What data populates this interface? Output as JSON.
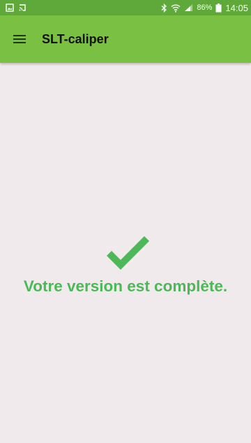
{
  "status_bar": {
    "battery_percent": "86%",
    "time": "14:05",
    "icons": [
      "gallery-notification-icon",
      "cast-notification-icon",
      "bluetooth-icon",
      "wifi-icon",
      "signal-icon",
      "battery-icon"
    ]
  },
  "app_bar": {
    "title": "SLT-caliper",
    "menu_icon": "hamburger-menu-icon"
  },
  "content": {
    "icon": "check-icon",
    "message": "Votre version est complète."
  },
  "colors": {
    "status_bar": "#5fa83a",
    "app_bar": "#7ac143",
    "background": "#f1eaec",
    "accent": "#4cb858"
  }
}
